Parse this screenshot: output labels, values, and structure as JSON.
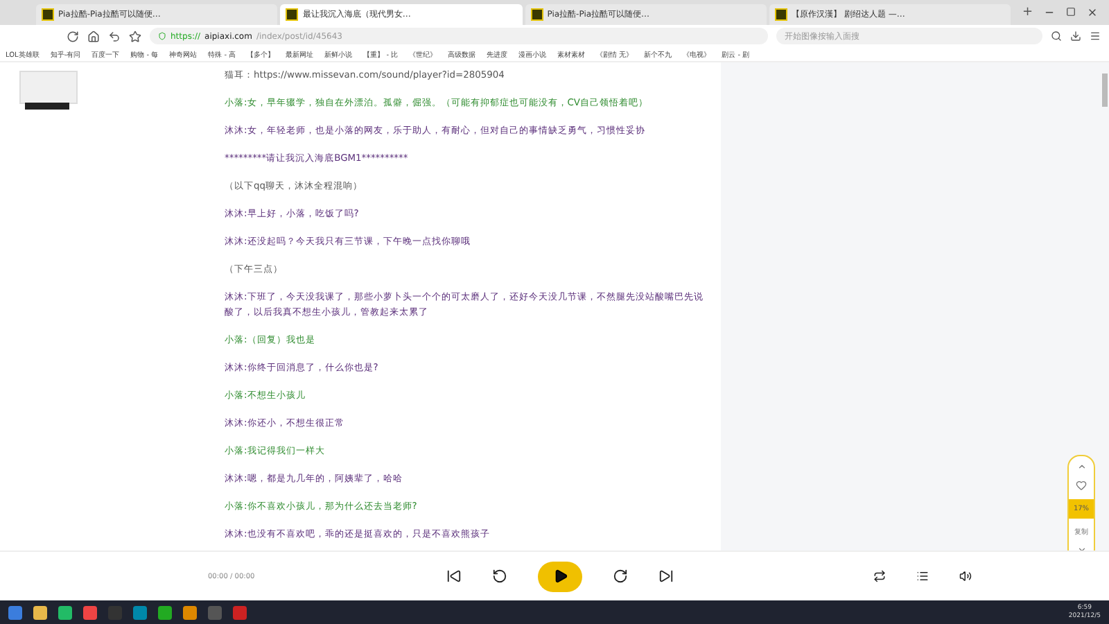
{
  "browser": {
    "tabs": [
      {
        "title": "Pia拉酷-Pia拉酷可以随便…",
        "selected": false
      },
      {
        "title": "最让我沉入海底（现代男女…",
        "selected": true
      },
      {
        "title": "Pia拉酷-Pia拉酷可以随便…",
        "selected": false
      },
      {
        "title": "【原作汉漢】 剧绍达人题 —…",
        "selected": false
      }
    ],
    "new_tab": "+",
    "url_secure": "https://",
    "url_host": "aipiaxi.com",
    "url_path": "/index/post/id/45643",
    "search_placeholder": "开始图像按输入面搜",
    "bookmarks": [
      "LOL英雄联",
      "知乎-有问",
      "百度一下",
      "购物 - 每",
      "神奇网站",
      "特殊 - 高",
      "【多个】",
      "最新网址",
      "新鲜小说",
      "【重】 - 比",
      "《世纪》",
      "高级数据",
      "先进度",
      "漫画小说",
      "素材素材",
      "《剧情 无》",
      "新个不九",
      "《电视》",
      "剧云 - 剧"
    ]
  },
  "article": {
    "lines": [
      {
        "text": "猫耳：https://www.missevan.com/sound/player?id=2805904",
        "kind": "note"
      },
      {
        "text": "小落:女，早年辍学，独自在外漂泊。孤僻，倔强。（可能有抑郁症也可能没有，CV自己领悟着吧）",
        "kind": "xiaoluo"
      },
      {
        "text": "沐沐:女，年轻老师，也是小落的网友，乐于助人，有耐心，但对自己的事情缺乏勇气，习惯性妥协",
        "kind": "mumu"
      },
      {
        "text": "*********请让我沉入海底BGM1**********",
        "kind": "mumu"
      },
      {
        "text": "（以下qq聊天，沐沐全程混响）",
        "kind": "note"
      },
      {
        "text": "沐沐:早上好，小落，吃饭了吗?",
        "kind": "mumu"
      },
      {
        "text": "沐沐:还没起吗？今天我只有三节课，下午晚一点找你聊哦",
        "kind": "mumu"
      },
      {
        "text": "（下午三点）",
        "kind": "note"
      },
      {
        "text": "沐沐:下班了，今天没我课了，那些小萝卜头一个个的可太磨人了，还好今天没几节课，不然腿先没站酸嘴巴先说酸了，以后我真不想生小孩儿，管教起来太累了",
        "kind": "mumu"
      },
      {
        "text": "小落:（回复）我也是",
        "kind": "xiaoluo"
      },
      {
        "text": "沐沐:你终于回消息了，什么你也是?",
        "kind": "mumu"
      },
      {
        "text": "小落:不想生小孩儿",
        "kind": "xiaoluo"
      },
      {
        "text": "沐沐:你还小，不想生很正常",
        "kind": "mumu"
      },
      {
        "text": "小落:我记得我们一样大",
        "kind": "xiaoluo"
      },
      {
        "text": "沐沐:嗯，都是九几年的，阿姨辈了，哈哈",
        "kind": "mumu"
      },
      {
        "text": "小落:你不喜欢小孩儿，那为什么还去当老师?",
        "kind": "xiaoluo"
      },
      {
        "text": "沐沐:也没有不喜欢吧，乖的还是挺喜欢的，只是不喜欢熊孩子",
        "kind": "mumu"
      }
    ]
  },
  "float_panel": {
    "percent": "17%",
    "copy": "复制"
  },
  "player": {
    "time": "00:00 / 00:00",
    "playing": false
  },
  "taskbar": {
    "time": "6:59",
    "date": "2021/12/5"
  }
}
